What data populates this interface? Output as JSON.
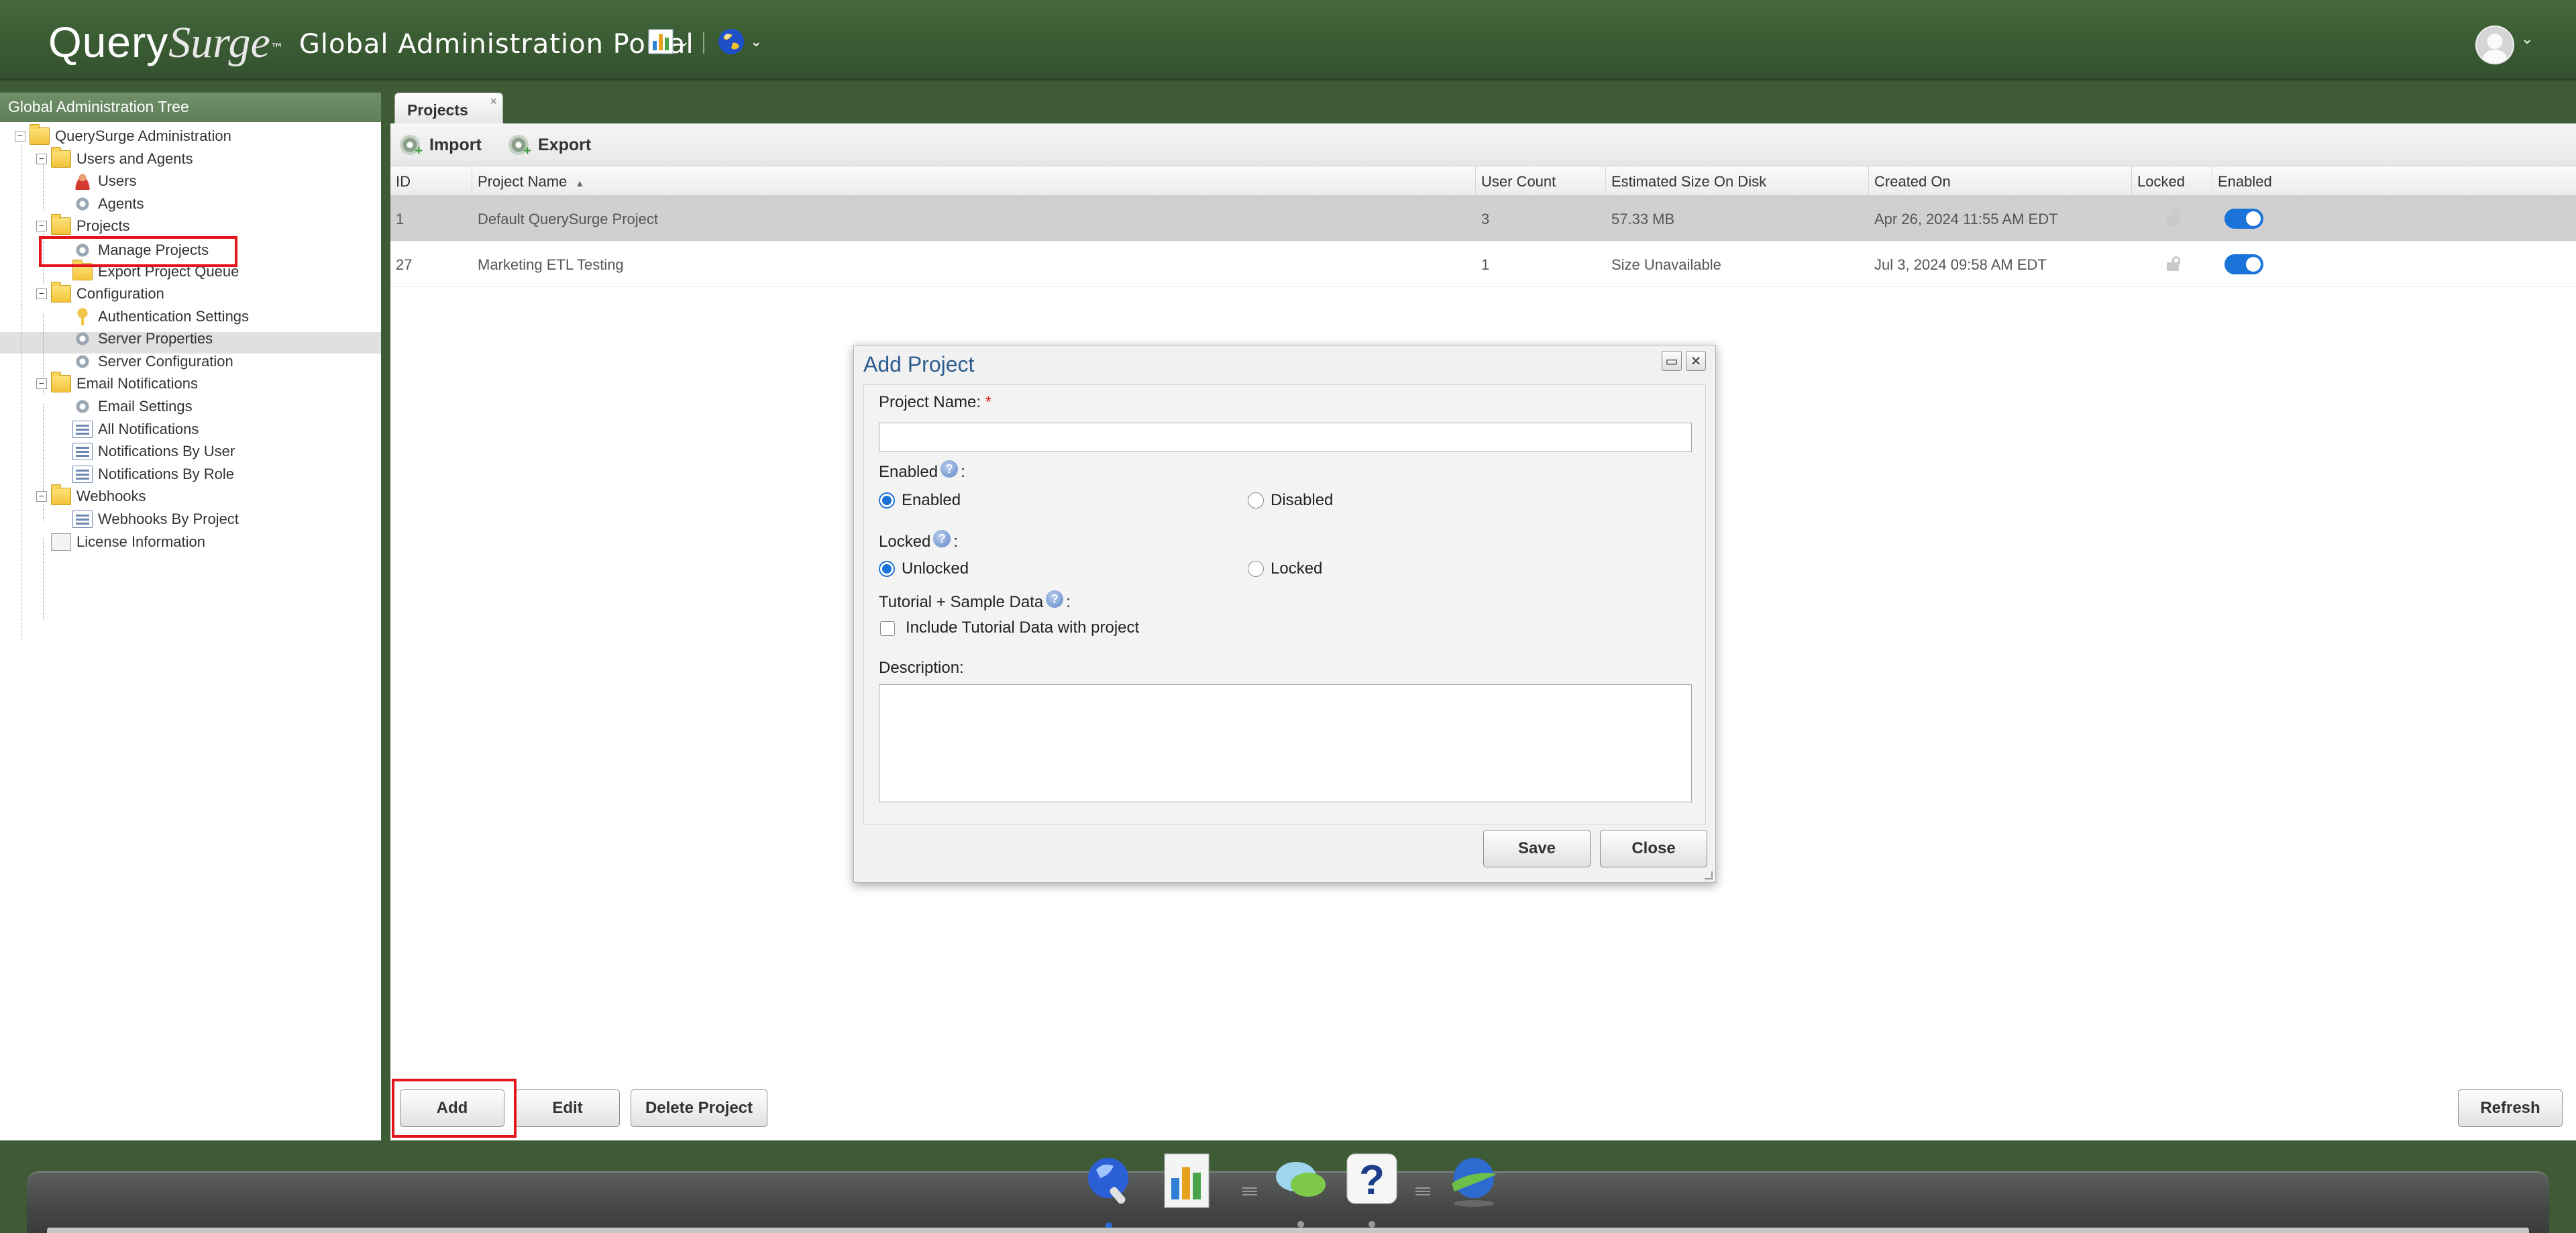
{
  "header": {
    "brand_query": "Query",
    "brand_surge": "Surge",
    "brand_tm": "™",
    "portal_title": "Global Administration Portal"
  },
  "sidebar": {
    "title": "Global Administration Tree",
    "items": [
      {
        "label": "QuerySurge Administration",
        "icon": "folder-icon"
      },
      {
        "label": "Users and Agents",
        "icon": "folder-users-icon"
      },
      {
        "label": "Users",
        "icon": "user-icon"
      },
      {
        "label": "Agents",
        "icon": "agent-icon"
      },
      {
        "label": "Projects",
        "icon": "folder-icon"
      },
      {
        "label": "Manage Projects",
        "icon": "gear-icon"
      },
      {
        "label": "Export Project Queue",
        "icon": "folder-icon"
      },
      {
        "label": "Configuration",
        "icon": "folder-icon"
      },
      {
        "label": "Authentication Settings",
        "icon": "key-icon"
      },
      {
        "label": "Server Properties",
        "icon": "gear-icon"
      },
      {
        "label": "Server Configuration",
        "icon": "gear-icon"
      },
      {
        "label": "Email Notifications",
        "icon": "folder-icon"
      },
      {
        "label": "Email Settings",
        "icon": "gear-icon"
      },
      {
        "label": "All Notifications",
        "icon": "list-icon"
      },
      {
        "label": "Notifications By User",
        "icon": "list-icon"
      },
      {
        "label": "Notifications By Role",
        "icon": "list-icon"
      },
      {
        "label": "Webhooks",
        "icon": "folder-icon"
      },
      {
        "label": "Webhooks By Project",
        "icon": "list-icon"
      },
      {
        "label": "License Information",
        "icon": "license-icon"
      }
    ]
  },
  "main": {
    "tab_label": "Projects",
    "tab_close": "×",
    "toolbar": {
      "import_label": "Import",
      "export_label": "Export"
    },
    "columns": [
      "ID",
      "Project Name",
      "User Count",
      "Estimated Size On Disk",
      "Created On",
      "Locked",
      "Enabled"
    ],
    "sort_indicator": "▲",
    "rows": [
      {
        "id": "1",
        "name": "Default QuerySurge Project",
        "user_count": "3",
        "size": "57.33 MB",
        "created": "Apr 26, 2024 11:55 AM EDT",
        "locked": false,
        "enabled": true
      },
      {
        "id": "27",
        "name": "Marketing ETL Testing",
        "user_count": "1",
        "size": "Size Unavailable",
        "created": "Jul 3, 2024 09:58 AM EDT",
        "locked": false,
        "enabled": true
      }
    ],
    "buttons": {
      "add": "Add",
      "edit": "Edit",
      "delete": "Delete Project",
      "refresh": "Refresh"
    }
  },
  "dialog": {
    "title": "Add Project",
    "project_name_label": "Project Name:",
    "required_mark": "*",
    "project_name_value": "",
    "enabled_label": "Enabled",
    "locked_label": "Locked",
    "tutorial_label": "Tutorial + Sample Data",
    "colon": ":",
    "help_glyph": "?",
    "enabled_options": [
      "Enabled",
      "Disabled"
    ],
    "enabled_selected": "Enabled",
    "locked_options": [
      "Unlocked",
      "Locked"
    ],
    "locked_selected": "Unlocked",
    "tutorial_checkbox_label": "Include Tutorial Data with project",
    "tutorial_checked": false,
    "description_label": "Description:",
    "description_value": "",
    "save_label": "Save",
    "close_label": "Close",
    "maximize_glyph": "▭",
    "close_glyph": "✕"
  },
  "colors": {
    "header_green": "#3a5b33",
    "accent_blue": "#1a73d9",
    "highlight_red": "#e3141b",
    "dialog_title": "#2c5d8f"
  }
}
